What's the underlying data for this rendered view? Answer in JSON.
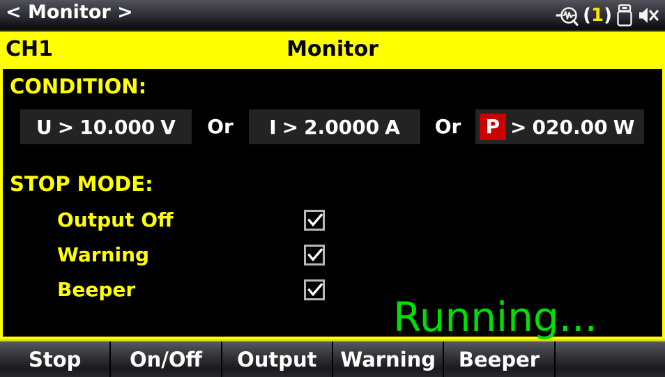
{
  "titlebar": {
    "title": "< Monitor >",
    "status": {
      "monitor_icon": "monitor-magnifier-icon",
      "monitor_count_open": "(",
      "monitor_count_value": "1",
      "monitor_count_close": ")",
      "usb_icon": "usb-drive-icon",
      "sound_icon": "speaker-mute-icon"
    }
  },
  "header": {
    "channel": "CH1",
    "title": "Monitor"
  },
  "main": {
    "condition_label": "CONDITION:",
    "conditions": [
      {
        "param": "U",
        "operator": ">",
        "value": "10.000",
        "unit": "V",
        "highlighted": false
      },
      {
        "param": "I",
        "operator": ">",
        "value": "2.0000",
        "unit": "A",
        "highlighted": false
      },
      {
        "param": "P",
        "operator": ">",
        "value": "020.00",
        "unit": "W",
        "highlighted": true
      }
    ],
    "joiners": [
      "Or",
      "Or"
    ],
    "stop_mode_label": "STOP MODE:",
    "stop_modes": [
      {
        "label": "Output Off",
        "checked": "true"
      },
      {
        "label": "Warning",
        "checked": "true"
      },
      {
        "label": "Beeper",
        "checked": "true"
      }
    ],
    "status_text": "Running...",
    "status_color": "#00e000"
  },
  "softkeys": [
    {
      "label": "Stop"
    },
    {
      "label": "On/Off"
    },
    {
      "label": "Output"
    },
    {
      "label": "Warning"
    },
    {
      "label": "Beeper"
    },
    {
      "label": ""
    }
  ],
  "colors": {
    "accent_yellow": "#ffff00",
    "highlight_red": "#cc0000",
    "running_green": "#00e000",
    "background": "#000000"
  }
}
